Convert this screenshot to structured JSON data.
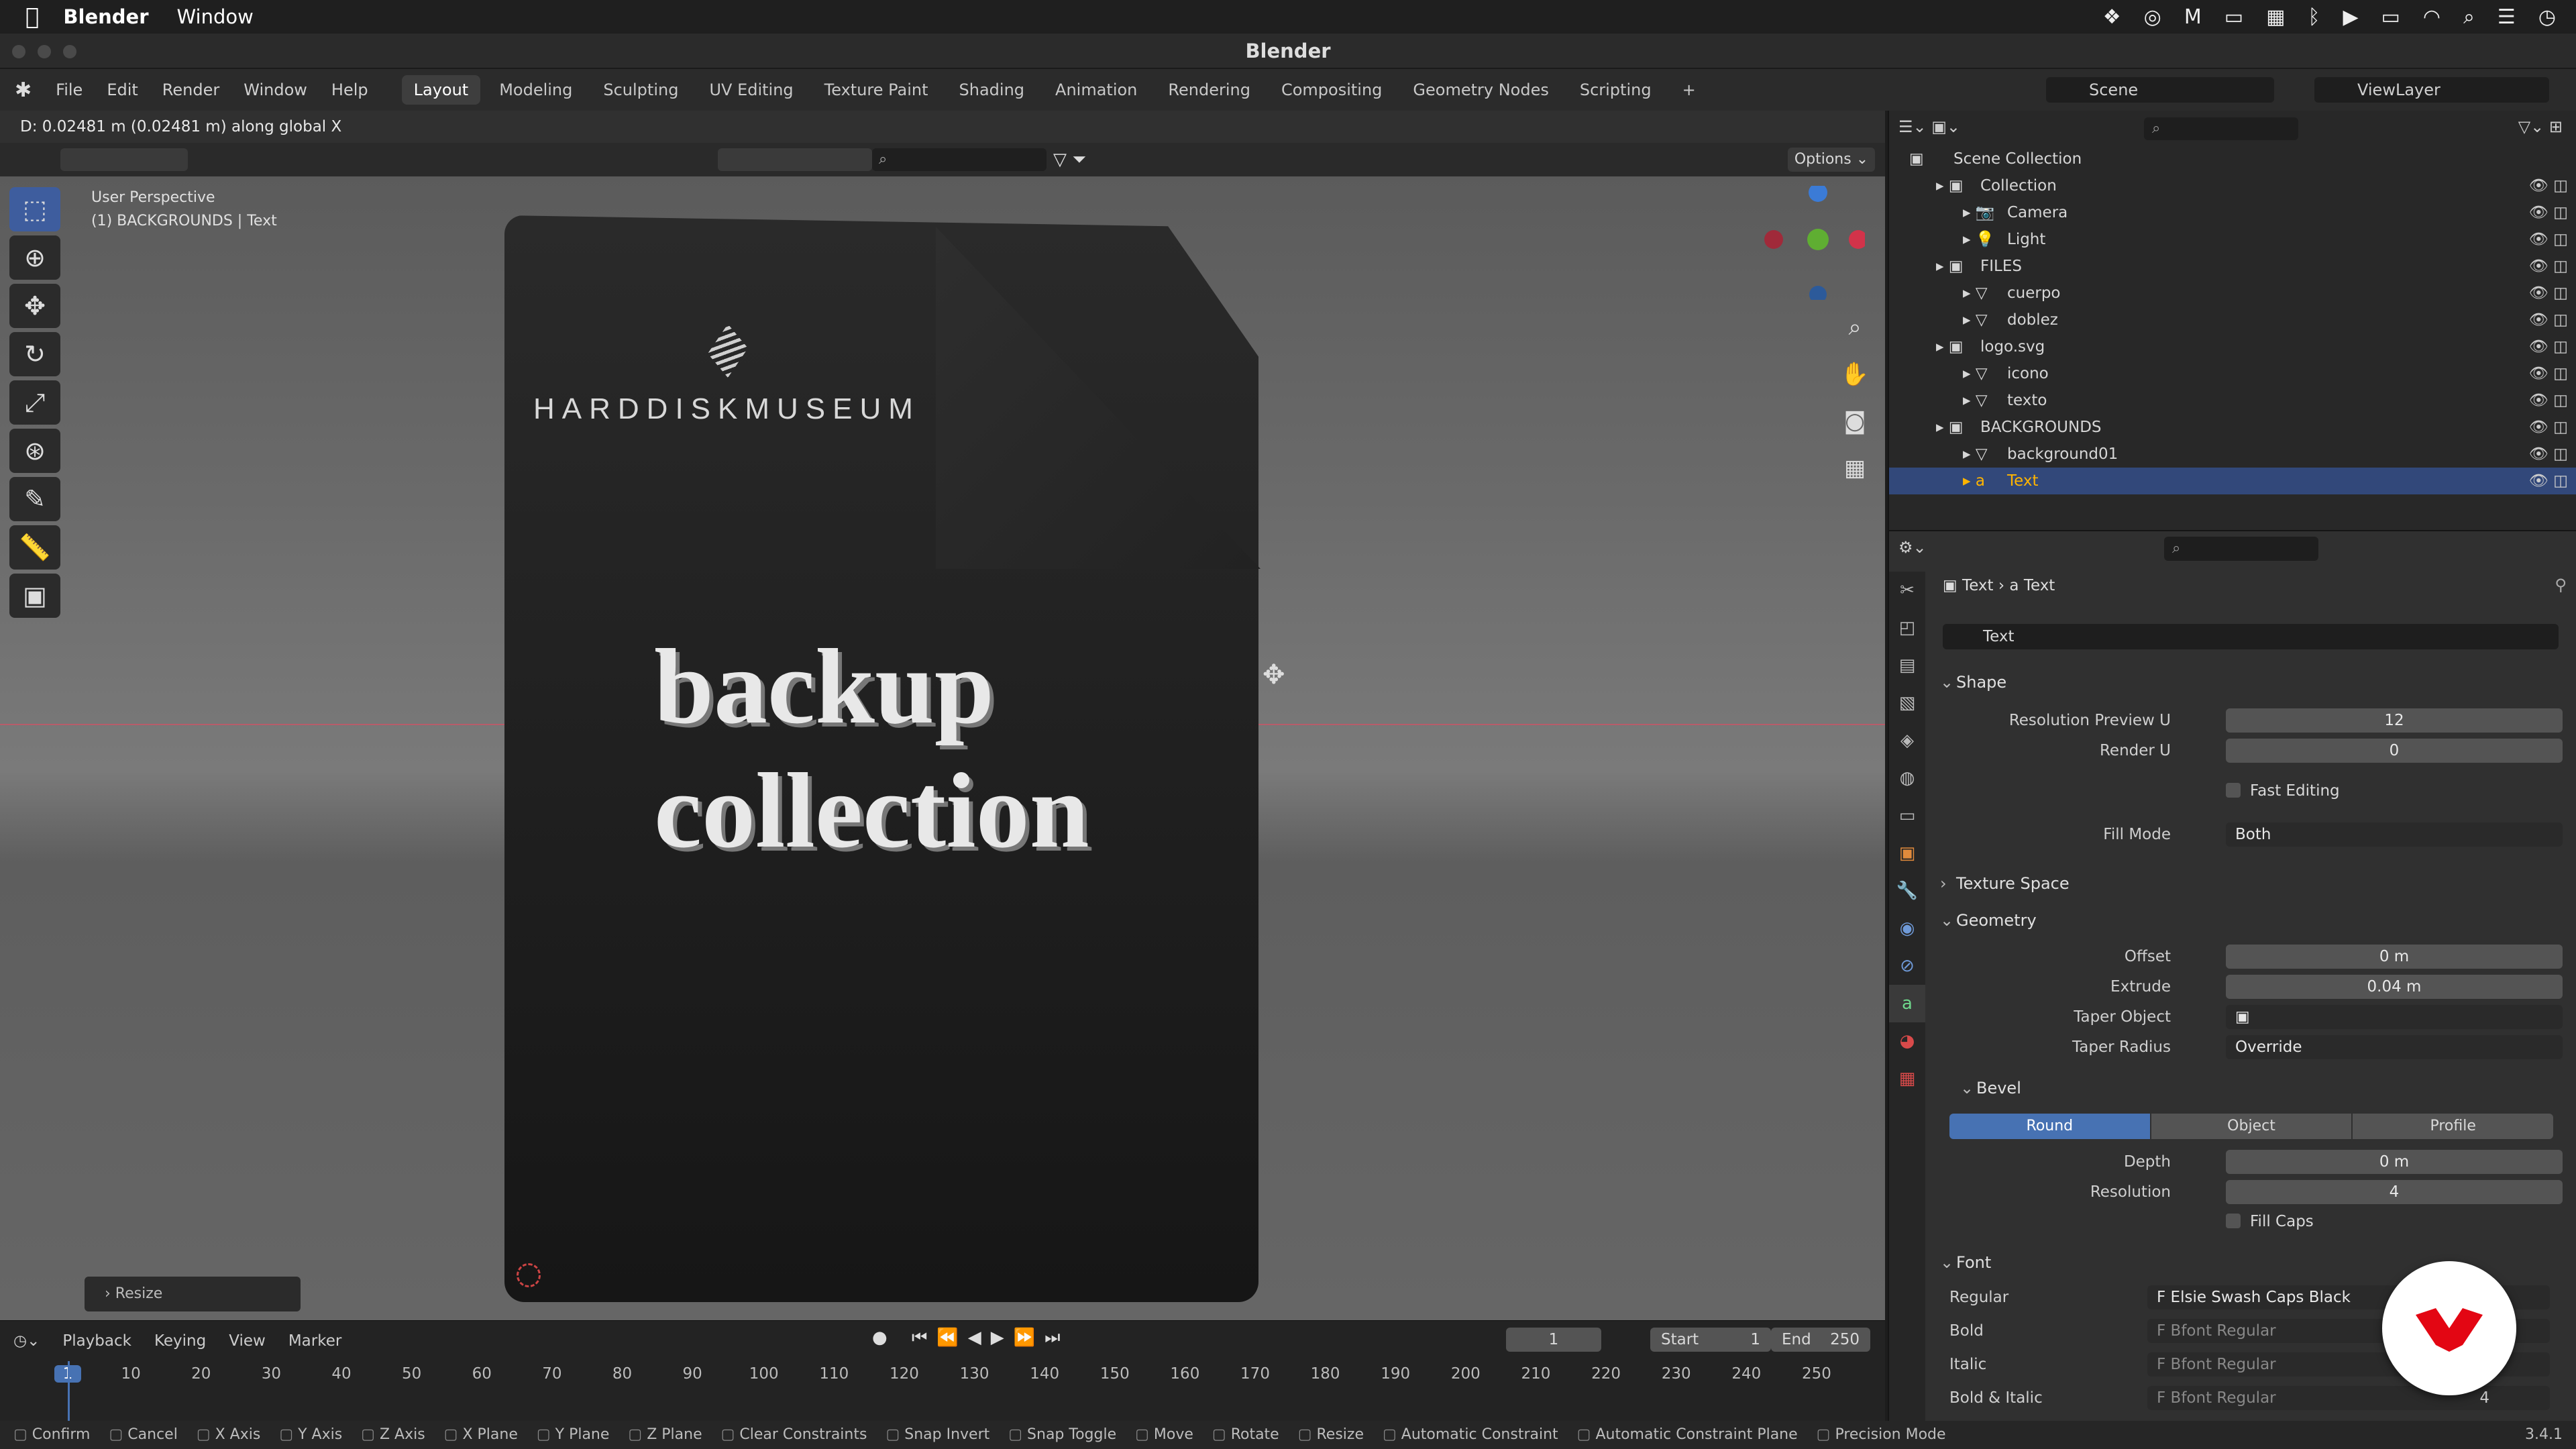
{
  "macbar": {
    "apple": "",
    "app": "Blender",
    "window": "Window"
  },
  "title": "Blender",
  "topbar": {
    "menus": [
      "File",
      "Edit",
      "Render",
      "Window",
      "Help"
    ],
    "workspaces": [
      "Layout",
      "Modeling",
      "Sculpting",
      "UV Editing",
      "Texture Paint",
      "Shading",
      "Animation",
      "Rendering",
      "Compositing",
      "Geometry Nodes",
      "Scripting",
      "+"
    ],
    "scene": "Scene",
    "viewlayer": "ViewLayer"
  },
  "viewport": {
    "header_info": "D: 0.02481 m (0.02481 m) along global X",
    "options": "Options",
    "overlay_title": "User Perspective",
    "overlay_sub": "(1) BACKGROUNDS | Text",
    "logo_text": "HARDDISKMUSEUM",
    "line1": "backup",
    "line2": "collection",
    "op_panel": "Resize"
  },
  "timeline": {
    "menus": [
      "Playback",
      "Keying",
      "View",
      "Marker"
    ],
    "frame": "1",
    "start_label": "Start",
    "start": "1",
    "end_label": "End",
    "end": "250",
    "ticks": [
      "1",
      "10",
      "20",
      "30",
      "40",
      "50",
      "60",
      "70",
      "80",
      "90",
      "100",
      "110",
      "120",
      "130",
      "140",
      "150",
      "160",
      "170",
      "180",
      "190",
      "200",
      "210",
      "220",
      "230",
      "240",
      "250"
    ]
  },
  "status": {
    "items": [
      "Confirm",
      "Cancel",
      "X Axis",
      "Y Axis",
      "Z Axis",
      "X Plane",
      "Y Plane",
      "Z Plane",
      "Clear Constraints",
      "Snap Invert",
      "Snap Toggle",
      "Move",
      "Rotate",
      "Resize",
      "Automatic Constraint",
      "Automatic Constraint Plane",
      "Precision Mode"
    ],
    "version": "3.4.1"
  },
  "outliner": {
    "rows": [
      {
        "label": "Scene Collection",
        "indent": 0
      },
      {
        "label": "Collection",
        "indent": 1
      },
      {
        "label": "Camera",
        "indent": 2
      },
      {
        "label": "Light",
        "indent": 2
      },
      {
        "label": "FILES",
        "indent": 1
      },
      {
        "label": "cuerpo",
        "indent": 2
      },
      {
        "label": "doblez",
        "indent": 2
      },
      {
        "label": "logo.svg",
        "indent": 1
      },
      {
        "label": "icono",
        "indent": 2
      },
      {
        "label": "texto",
        "indent": 2
      },
      {
        "label": "BACKGROUNDS",
        "indent": 1
      },
      {
        "label": "background01",
        "indent": 2
      },
      {
        "label": "Text",
        "indent": 2
      }
    ]
  },
  "props": {
    "breadcrumb1": "Text",
    "breadcrumb2": "Text",
    "datablock": "Text",
    "shape": "Shape",
    "res_preview_label": "Resolution Preview U",
    "res_preview": "12",
    "render_u_label": "Render U",
    "render_u": "0",
    "fast_editing": "Fast Editing",
    "fill_mode_label": "Fill Mode",
    "fill_mode": "Both",
    "texture_space": "Texture Space",
    "geometry": "Geometry",
    "offset_label": "Offset",
    "offset": "0 m",
    "extrude_label": "Extrude",
    "extrude": "0.04 m",
    "taper_object_label": "Taper Object",
    "taper_radius_label": "Taper Radius",
    "taper_radius": "Override",
    "bevel": "Bevel",
    "bevel_round": "Round",
    "bevel_object": "Object",
    "bevel_profile": "Profile",
    "depth_label": "Depth",
    "depth": "0 m",
    "resolution_label": "Resolution",
    "resolution": "4",
    "fill_caps": "Fill Caps",
    "font": "Font",
    "regular_label": "Regular",
    "regular": "Elsie Swash Caps Black",
    "bold_label": "Bold",
    "bold": "Bfont Regular",
    "italic_label": "Italic",
    "italic": "Bfont Regular",
    "bolditalic_label": "Bold & Italic",
    "bolditalic": "Bfont Regular",
    "bolditalic_users": "4"
  },
  "colors": {
    "accent": "#3e5d9e",
    "selected_row": "#32487a",
    "active_text": "#ffb400",
    "badge": "#e30613"
  }
}
